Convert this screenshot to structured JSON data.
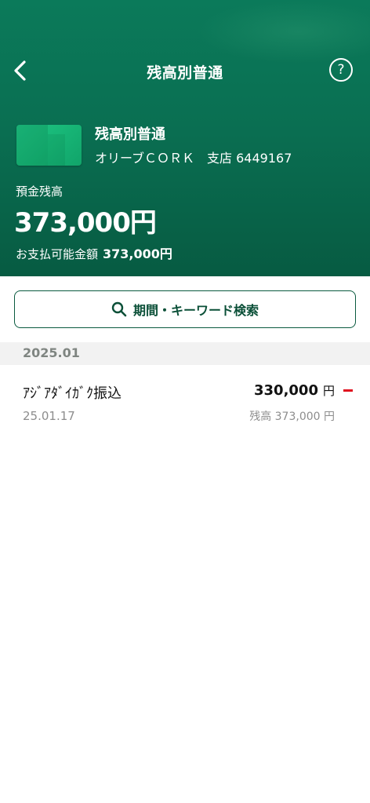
{
  "header": {
    "title": "残高別普通",
    "help_label": "?",
    "colors": {
      "primary": "#0a6f52",
      "deep": "#075b42",
      "debit": "#e0101f"
    }
  },
  "account": {
    "name": "残高別普通",
    "branch_line": "オリーブＣＯＲＫ　支店 6449167",
    "balance_label": "預金残高",
    "balance": "373,000円",
    "available_label": "お支払可能金額",
    "available_value": "373,000円"
  },
  "search": {
    "label": "期間・キーワード検索",
    "icon": "search-icon"
  },
  "transactions": {
    "month": "2025.01",
    "items": [
      {
        "description": "ｱｼﾞｱﾀﾞｲｶﾞｸ振込",
        "date": "25.01.17",
        "amount": "330,000",
        "unit": "円",
        "direction": "debit",
        "balance_after": "残高 373,000 円"
      }
    ]
  }
}
